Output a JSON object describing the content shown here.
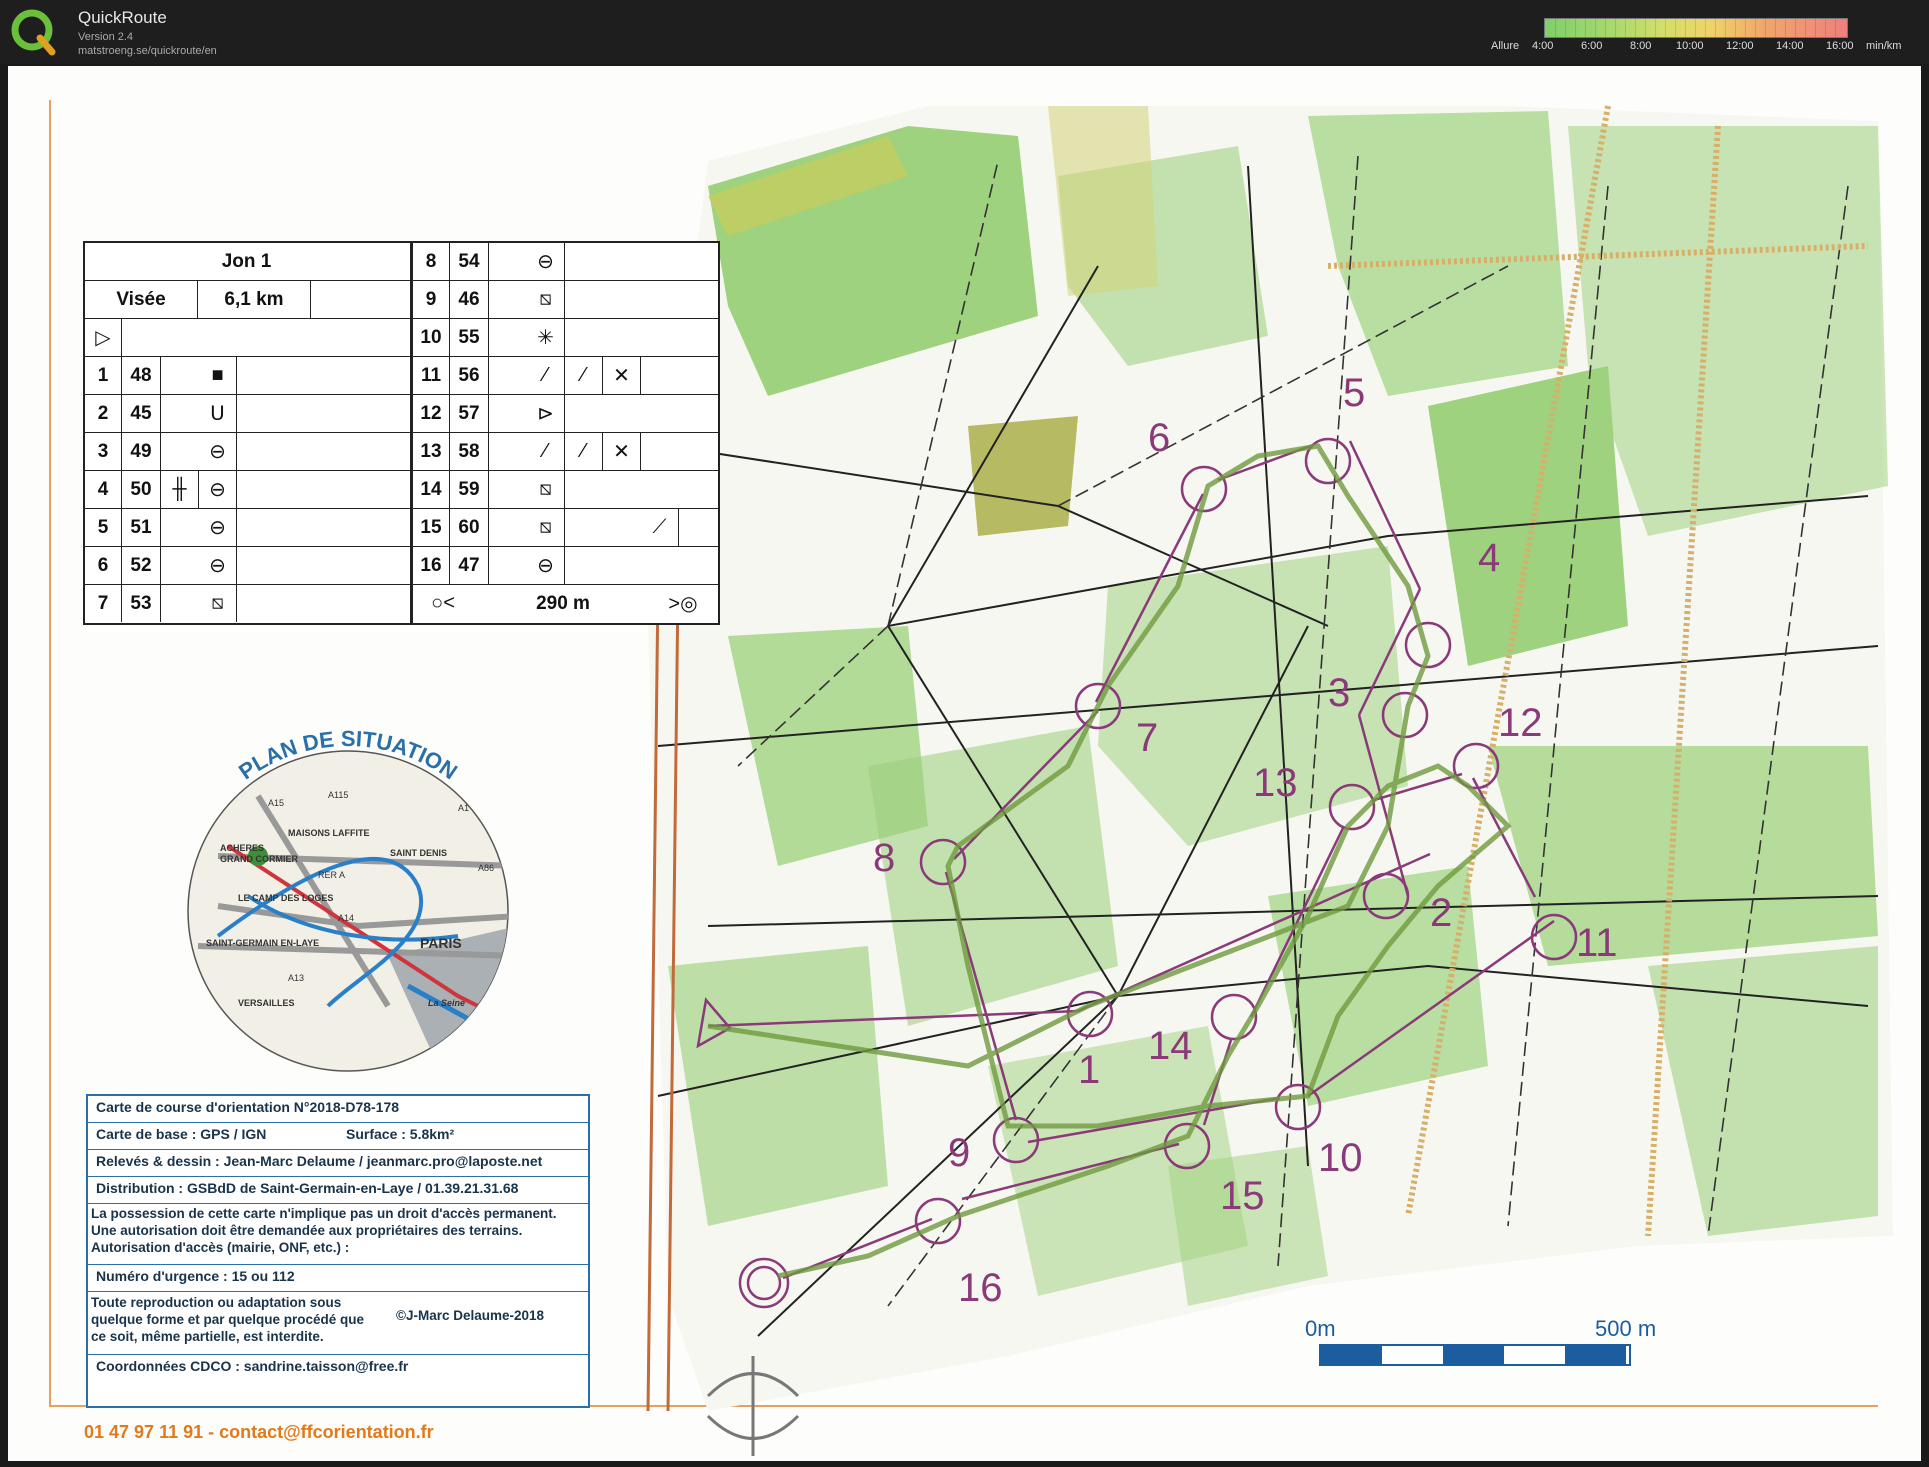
{
  "app": {
    "name": "QuickRoute",
    "version": "Version 2.4",
    "url": "matstroeng.se/quickroute/en"
  },
  "pace_scale": {
    "label": "Allure",
    "ticks": [
      "4:00",
      "6:00",
      "8:00",
      "10:00",
      "12:00",
      "14:00",
      "16:00"
    ],
    "unit": "min/km"
  },
  "course": {
    "title": "Jon 1",
    "class": "Visée",
    "length": "6,1 km",
    "controls": [
      {
        "n": "1",
        "code": "48"
      },
      {
        "n": "2",
        "code": "45"
      },
      {
        "n": "3",
        "code": "49"
      },
      {
        "n": "4",
        "code": "50"
      },
      {
        "n": "5",
        "code": "51"
      },
      {
        "n": "6",
        "code": "52"
      },
      {
        "n": "7",
        "code": "53"
      },
      {
        "n": "8",
        "code": "54"
      },
      {
        "n": "9",
        "code": "46"
      },
      {
        "n": "10",
        "code": "55"
      },
      {
        "n": "11",
        "code": "56"
      },
      {
        "n": "12",
        "code": "57"
      },
      {
        "n": "13",
        "code": "58"
      },
      {
        "n": "14",
        "code": "59"
      },
      {
        "n": "15",
        "code": "60"
      },
      {
        "n": "16",
        "code": "47"
      }
    ],
    "finish_distance": "290 m"
  },
  "situation_plan": {
    "title": "PLAN DE SITUATION",
    "places": [
      "ACHERES",
      "GRAND CORMIER",
      "MAISONS LAFFITE",
      "SAINT DENIS",
      "LE CAMP DES LOGES",
      "PARIS",
      "SAINT-GERMAIN EN-LAYE",
      "VERSAILLES",
      "La Seine"
    ],
    "roads": [
      "A15",
      "A115",
      "A1",
      "A86",
      "A14",
      "A13",
      "RER A"
    ]
  },
  "info": {
    "map_id": "Carte de course d'orientation N°2018-D78-178",
    "base_map": "Carte de base : GPS / IGN",
    "surface": "Surface : 5.8km²",
    "survey": "Relevés & dessin : Jean-Marc Delaume  /  jeanmarc.pro@laposte.net",
    "distribution": "Distribution : GSBdD de Saint-Germain-en-Laye / 01.39.21.31.68",
    "access_1": "La possession de cette carte n'implique pas un droit d'accès permanent.",
    "access_2": "Une autorisation doit être demandée aux propriétaires des terrains.",
    "access_3": "Autorisation d'accès (mairie, ONF, etc.) :",
    "emergency": "Numéro d'urgence : 15 ou 112",
    "copyright_1": "Toute reproduction ou adaptation sous",
    "copyright_2": "quelque forme et par quelque procédé que",
    "copyright_3": "ce soit, même partielle, est interdite.",
    "copyright_owner": "©J-Marc Delaume-2018",
    "coordinates": "Coordonnées CDCO : sandrine.taisson@free.fr"
  },
  "contact": "01 47 97 11 91 - contact@ffcorientation.fr",
  "scale": {
    "start": "0m",
    "end": "500 m"
  },
  "colors": {
    "course": "#8a3a78",
    "route": "#6f9a3e",
    "forest": "#7cc05a",
    "info_blue": "#2a6fa8",
    "contact_orange": "#e07a1a"
  }
}
